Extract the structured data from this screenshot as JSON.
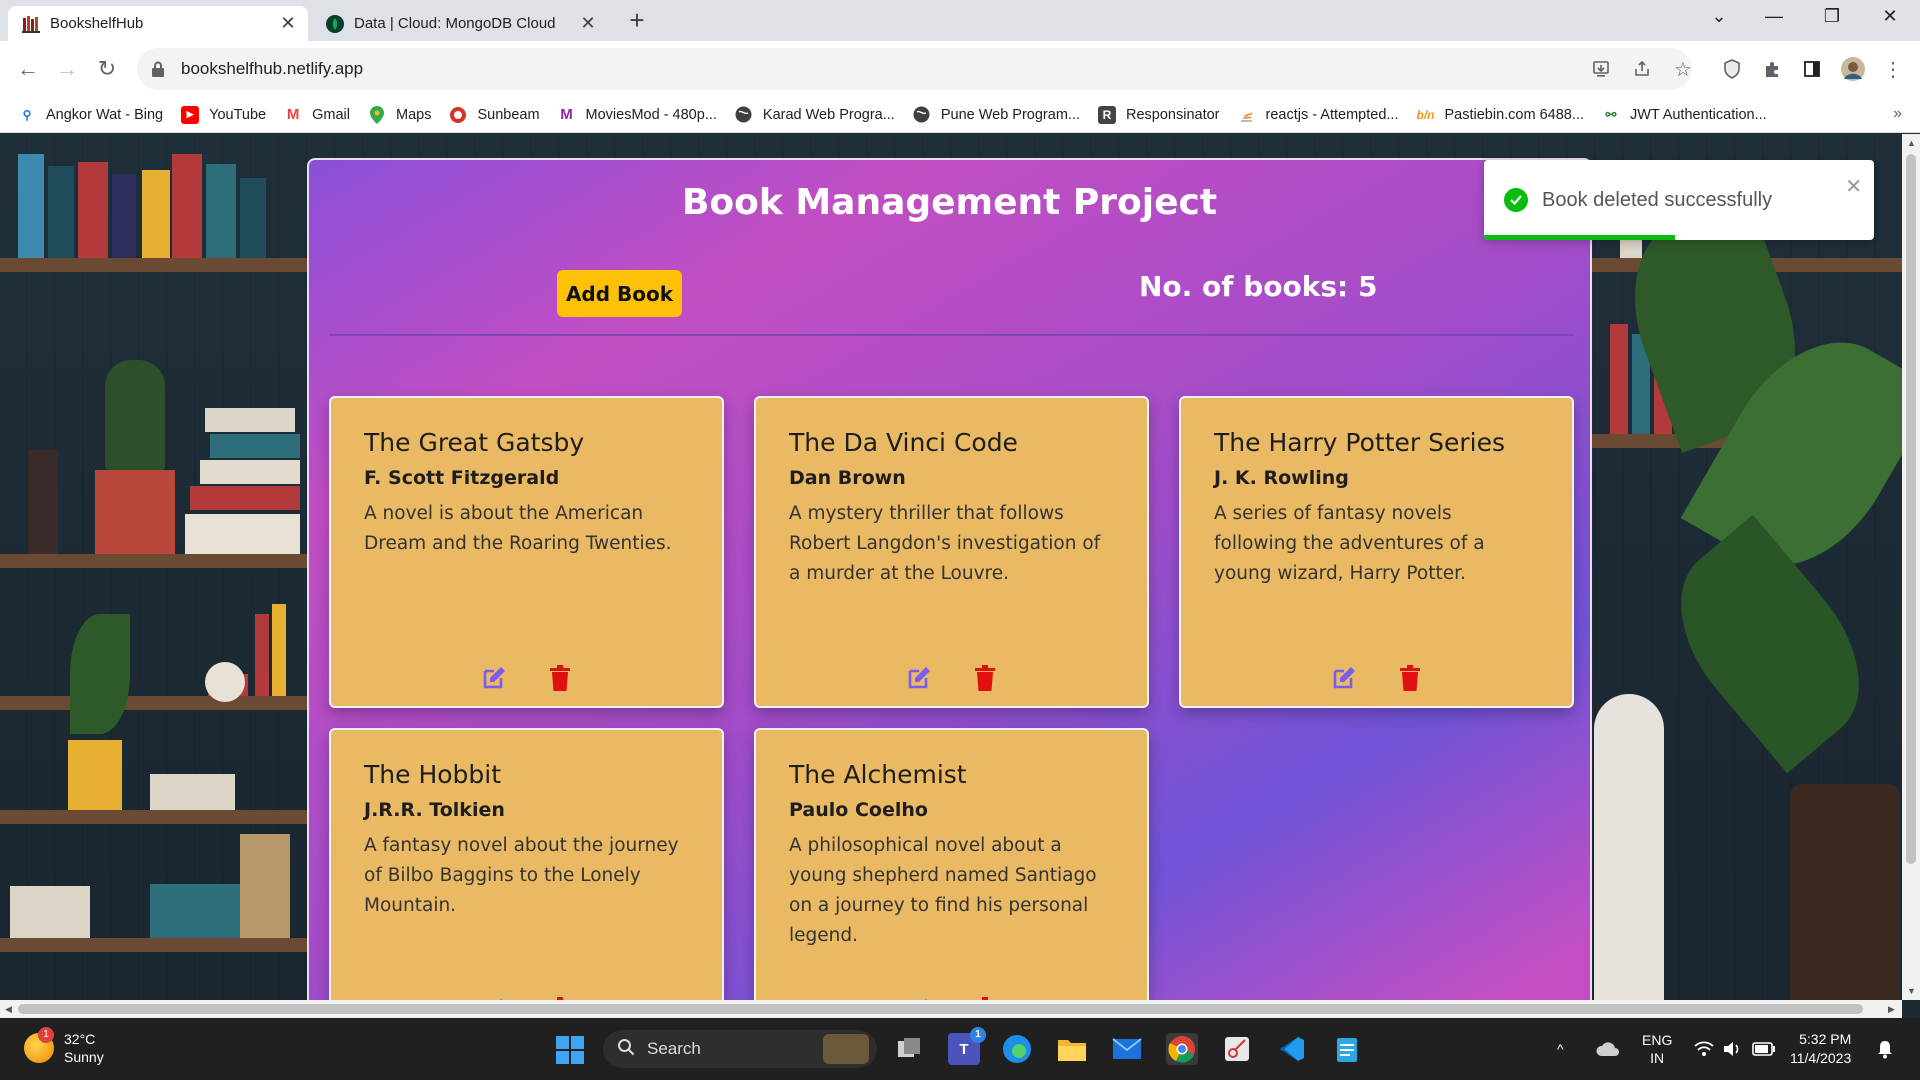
{
  "browser": {
    "tabs": [
      {
        "title": "BookshelfHub",
        "active": true
      },
      {
        "title": "Data | Cloud: MongoDB Cloud",
        "active": false
      }
    ],
    "new_tab": "+",
    "url": "bookshelfhub.netlify.app",
    "bookmarks": [
      {
        "label": "Angkor Wat - Bing",
        "icon": "bing-search-icon",
        "color": "#1a73e8"
      },
      {
        "label": "YouTube",
        "icon": "youtube-icon",
        "color": "#ff0000"
      },
      {
        "label": "Gmail",
        "icon": "gmail-icon",
        "color": "#ea4335"
      },
      {
        "label": "Maps",
        "icon": "maps-icon",
        "color": "#34a853"
      },
      {
        "label": "Sunbeam",
        "icon": "sunbeam-icon",
        "color": "#d93025"
      },
      {
        "label": "MoviesMod - 480p...",
        "icon": "moviesmod-icon",
        "color": "#8e24aa"
      },
      {
        "label": "Karad Web Progra...",
        "icon": "globe-icon",
        "color": "#3c4043"
      },
      {
        "label": "Pune Web Program...",
        "icon": "globe-icon",
        "color": "#3c4043"
      },
      {
        "label": "Responsinator",
        "icon": "responsinator-icon",
        "color": "#444444"
      },
      {
        "label": "reactjs - Attempted...",
        "icon": "stackoverflow-icon",
        "color": "#f48024"
      },
      {
        "label": "Pastiebin.com 6488...",
        "icon": "pastebin-icon",
        "color": "#f29a1c"
      },
      {
        "label": "JWT Authentication...",
        "icon": "jwt-icon",
        "color": "#2e7d32"
      }
    ]
  },
  "app": {
    "title": "Book Management Project",
    "add_button": "Add Book",
    "count_text": "No. of books: 5",
    "books": [
      {
        "title": "The Great Gatsby",
        "author": "F. Scott Fitzgerald",
        "description": "A novel is about the American Dream and the Roaring Twenties."
      },
      {
        "title": "The Da Vinci Code",
        "author": "Dan Brown",
        "description": "A mystery thriller that follows Robert Langdon's investigation of a murder at the Louvre."
      },
      {
        "title": "The Harry Potter Series",
        "author": "J. K. Rowling",
        "description": "A series of fantasy novels following the adventures of a young wizard, Harry Potter."
      },
      {
        "title": "The Hobbit",
        "author": "J.R.R. Tolkien",
        "description": "A fantasy novel about the journey of Bilbo Baggins to the Lonely Mountain."
      },
      {
        "title": "The Alchemist",
        "author": "Paulo Coelho",
        "description": "A philosophical novel about a young shepherd named Santiago on a journey to find his personal legend."
      }
    ],
    "colors": {
      "card_bg": "#eab964",
      "accent_button": "#ffc107",
      "edit_icon": "#7b5cf0",
      "delete_icon": "#e01010"
    }
  },
  "toast": {
    "message": "Book deleted successfully",
    "type": "success",
    "progress_remaining": 0.49,
    "color": "#07bc0c"
  },
  "taskbar": {
    "weather_temp": "32°C",
    "weather_desc": "Sunny",
    "weather_badge": "1",
    "search_label": "Search",
    "teams_badge": "1",
    "lang": "ENG",
    "region": "IN",
    "time": "5:32 PM",
    "date": "11/4/2023"
  }
}
